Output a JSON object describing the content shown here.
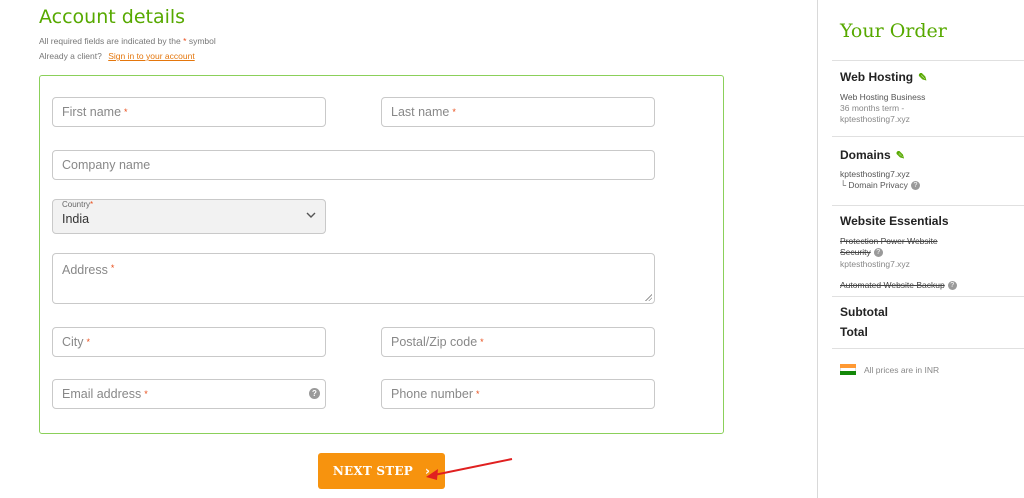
{
  "form": {
    "title": "Account details",
    "required_note_prefix": "All required fields are indicated by the",
    "required_star": "*",
    "required_note_suffix": "symbol",
    "client_prompt": "Already a client?",
    "sign_in_link": "Sign in to your account",
    "fields": {
      "first_name": "First name",
      "last_name": "Last name",
      "company": "Company name",
      "country_label": "Country",
      "country_value": "India",
      "address": "Address",
      "city": "City",
      "postal": "Postal/Zip code",
      "email": "Email address",
      "phone": "Phone number"
    },
    "star": "*",
    "help_glyph": "?",
    "next_button": "NEXT STEP",
    "next_arrow": "›"
  },
  "sidebar": {
    "title": "Your Order",
    "web_hosting": {
      "heading": "Web Hosting",
      "plan": "Web Hosting Business",
      "term": "36 months term -",
      "domain": "kptesthosting7.xyz"
    },
    "domains": {
      "heading": "Domains",
      "domain": "kptesthosting7.xyz",
      "privacy": "└ Domain Privacy"
    },
    "essentials": {
      "heading": "Website Essentials",
      "item1_line1": "Protection Power Website",
      "item1_line2": "Security",
      "item1_domain": "kptesthosting7.xyz",
      "item2": "Automated Website Backup"
    },
    "subtotal": "Subtotal",
    "total": "Total",
    "prices_note": "All prices are in INR",
    "pencil_glyph": "✎",
    "help_glyph": "?"
  },
  "colors": {
    "accent_green": "#57a900",
    "button_orange": "#f7930e",
    "annotation_red": "#e02020"
  }
}
